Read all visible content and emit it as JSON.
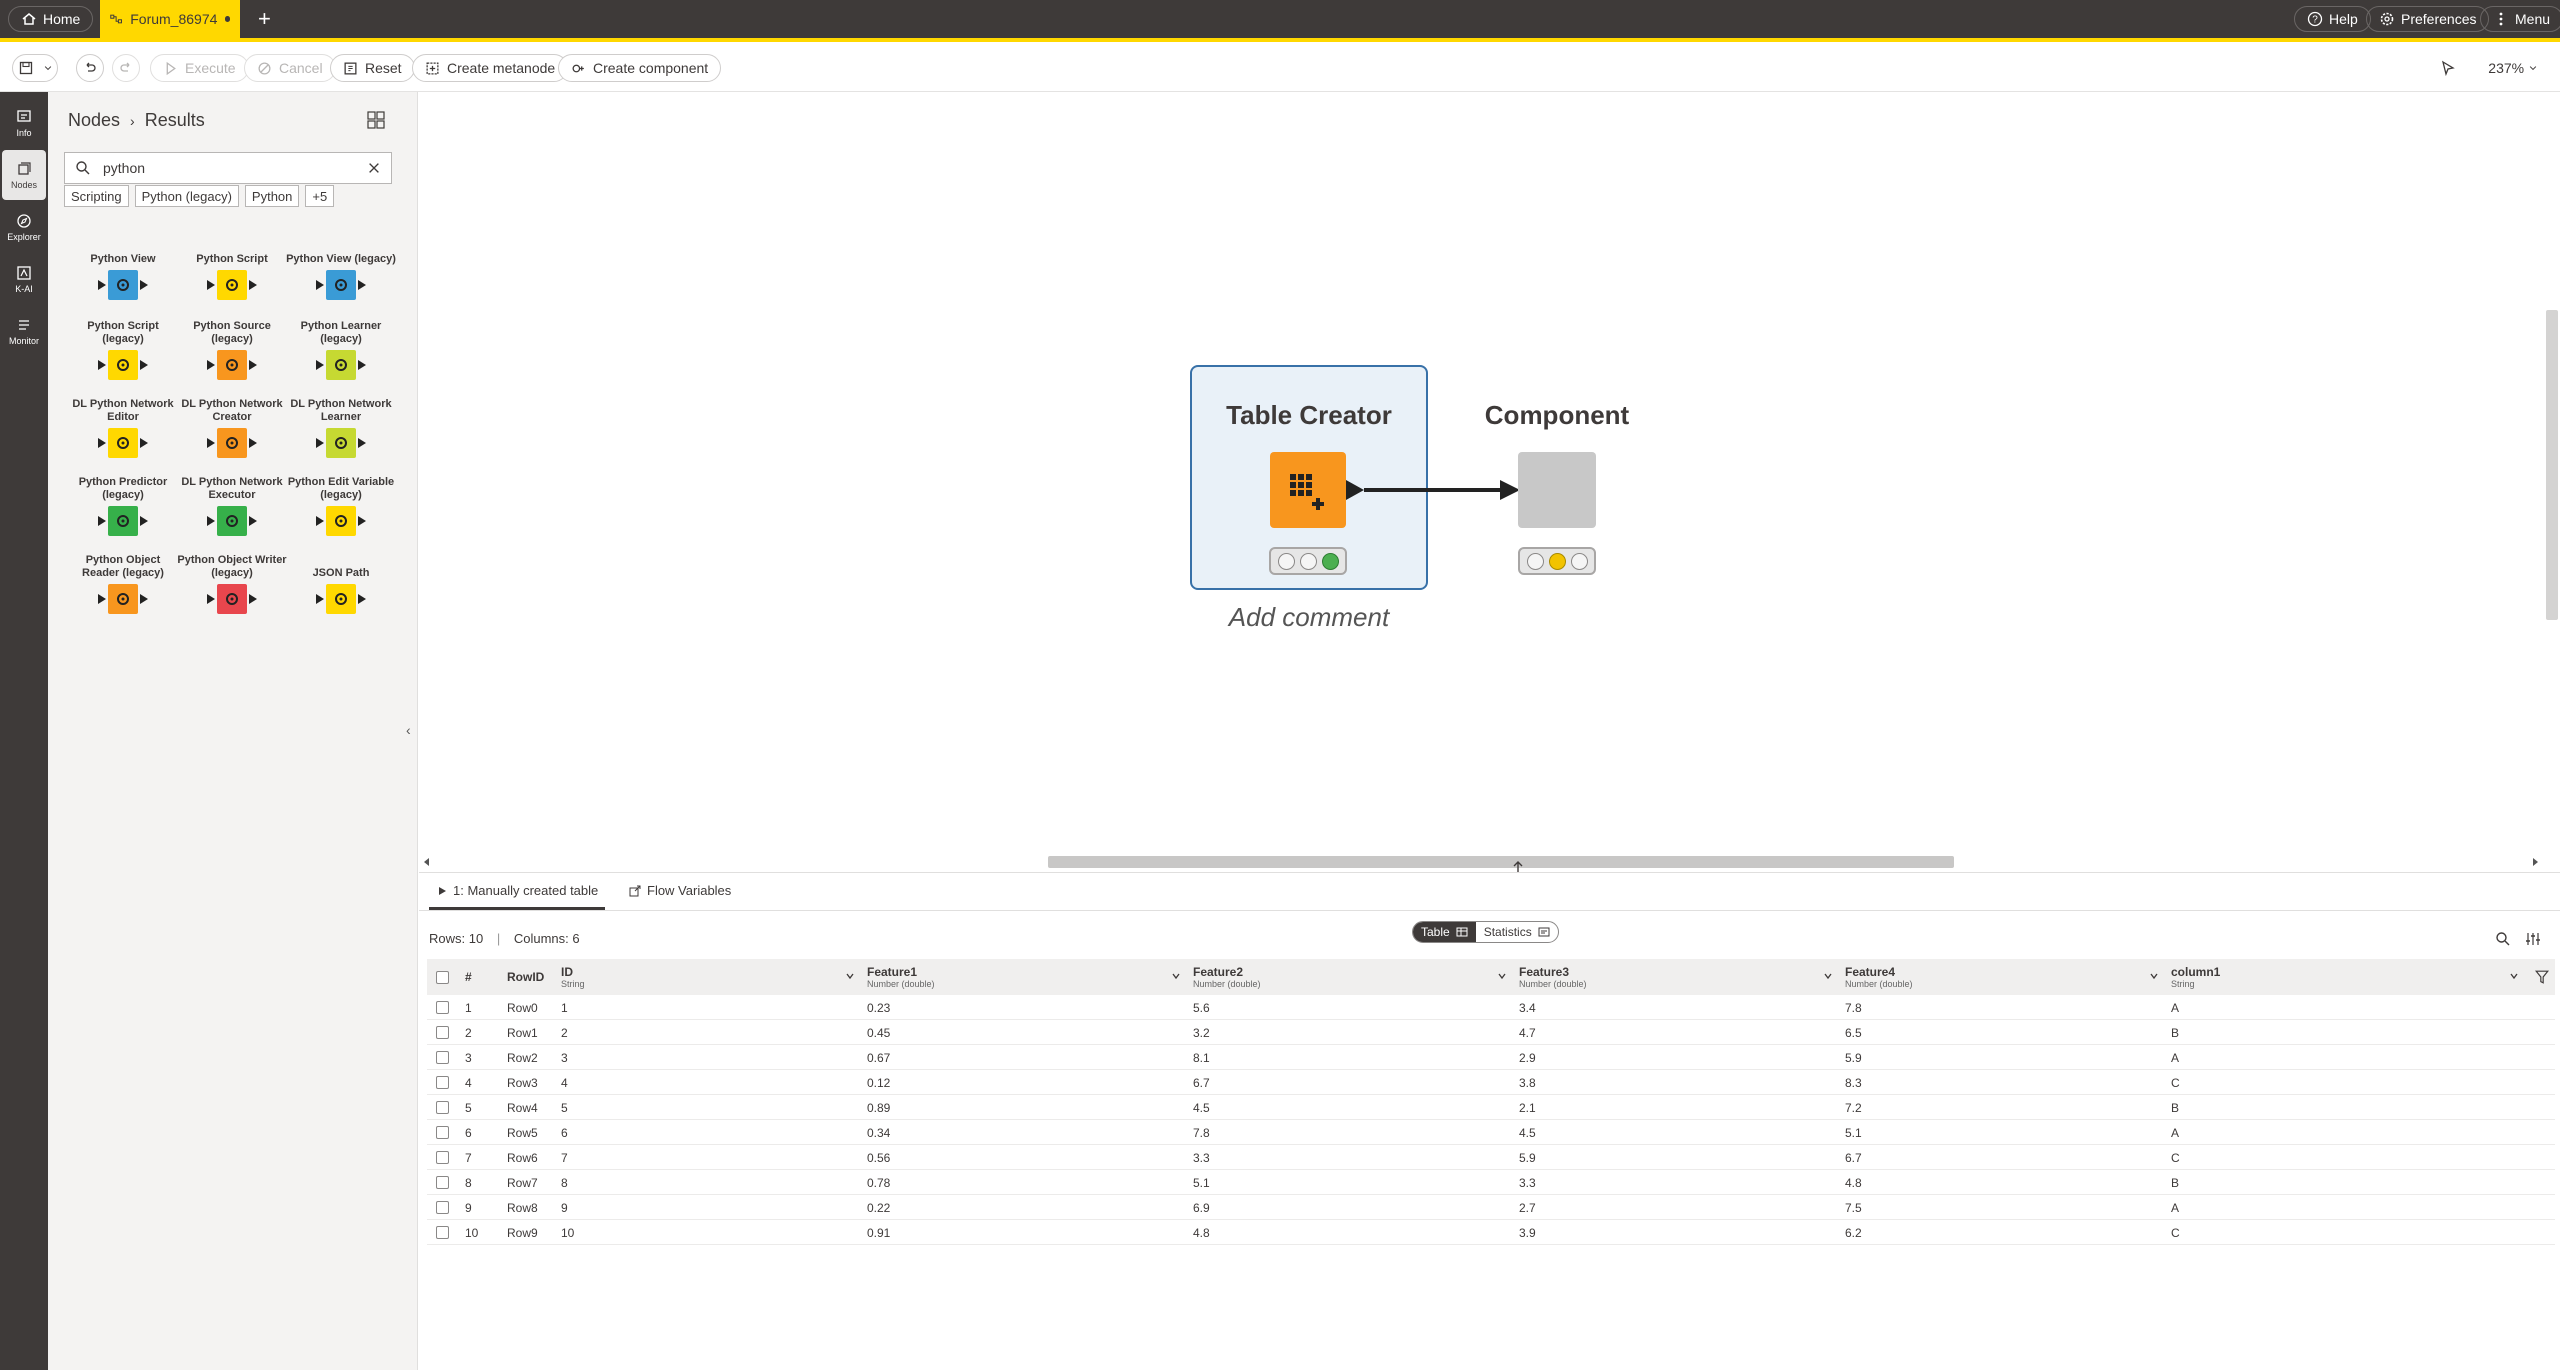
{
  "topbar": {
    "home_label": "Home",
    "tab_label": "Forum_86974",
    "new_tab": "+",
    "help_label": "Help",
    "preferences_label": "Preferences",
    "menu_label": "Menu",
    "accent_color": "#ffd800"
  },
  "toolbar": {
    "execute_label": "Execute",
    "cancel_label": "Cancel",
    "reset_label": "Reset",
    "create_metanode_label": "Create metanode",
    "create_component_label": "Create component",
    "zoom": "237%"
  },
  "rail": {
    "items": [
      {
        "label": "Info",
        "icon": "info-icon"
      },
      {
        "label": "Nodes",
        "icon": "nodes-icon"
      },
      {
        "label": "Explorer",
        "icon": "explorer-icon"
      },
      {
        "label": "K-AI",
        "icon": "kai-icon"
      },
      {
        "label": "Monitor",
        "icon": "monitor-icon"
      }
    ]
  },
  "panel": {
    "breadcrumb_root": "Nodes",
    "breadcrumb_sep": "›",
    "breadcrumb_current": "Results",
    "search_value": "python",
    "tags": [
      "Scripting",
      "Python (legacy)",
      "Python",
      "+5"
    ],
    "nodes": [
      {
        "label": "Python View",
        "color": "#3a9bd6"
      },
      {
        "label": "Python Script",
        "color": "#ffd800"
      },
      {
        "label": "Python View (legacy)",
        "color": "#3a9bd6"
      },
      {
        "label": "Python Script (legacy)",
        "color": "#ffd800"
      },
      {
        "label": "Python Source (legacy)",
        "color": "#f8961e"
      },
      {
        "label": "Python Learner (legacy)",
        "color": "#c6d932"
      },
      {
        "label": "DL Python Network Editor",
        "color": "#ffd800"
      },
      {
        "label": "DL Python Network Creator",
        "color": "#f8961e"
      },
      {
        "label": "DL Python Network Learner",
        "color": "#c6d932"
      },
      {
        "label": "Python Predictor (legacy)",
        "color": "#36b04a"
      },
      {
        "label": "DL Python Network Executor",
        "color": "#36b04a"
      },
      {
        "label": "Python Edit Variable (legacy)",
        "color": "#ffd800"
      },
      {
        "label": "Python Object Reader (legacy)",
        "color": "#f8961e"
      },
      {
        "label": "Python Object Writer (legacy)",
        "color": "#e8464d"
      },
      {
        "label": "JSON Path",
        "color": "#ffd800"
      }
    ]
  },
  "canvas": {
    "node1_title": "Table Creator",
    "node2_title": "Component",
    "comment": "Add comment"
  },
  "bottom": {
    "tab1": "1: Manually created table",
    "tab2": "Flow Variables",
    "rows_label": "Rows: 10",
    "cols_label": "Columns: 6",
    "seg_table": "Table",
    "seg_stats": "Statistics",
    "columns": [
      {
        "name": "#",
        "type": ""
      },
      {
        "name": "RowID",
        "type": ""
      },
      {
        "name": "ID",
        "type": "String"
      },
      {
        "name": "Feature1",
        "type": "Number (double)"
      },
      {
        "name": "Feature2",
        "type": "Number (double)"
      },
      {
        "name": "Feature3",
        "type": "Number (double)"
      },
      {
        "name": "Feature4",
        "type": "Number (double)"
      },
      {
        "name": "column1",
        "type": "String"
      }
    ],
    "rows": [
      [
        "1",
        "Row0",
        "1",
        "0.23",
        "5.6",
        "3.4",
        "7.8",
        "A"
      ],
      [
        "2",
        "Row1",
        "2",
        "0.45",
        "3.2",
        "4.7",
        "6.5",
        "B"
      ],
      [
        "3",
        "Row2",
        "3",
        "0.67",
        "8.1",
        "2.9",
        "5.9",
        "A"
      ],
      [
        "4",
        "Row3",
        "4",
        "0.12",
        "6.7",
        "3.8",
        "8.3",
        "C"
      ],
      [
        "5",
        "Row4",
        "5",
        "0.89",
        "4.5",
        "2.1",
        "7.2",
        "B"
      ],
      [
        "6",
        "Row5",
        "6",
        "0.34",
        "7.8",
        "4.5",
        "5.1",
        "A"
      ],
      [
        "7",
        "Row6",
        "7",
        "0.56",
        "3.3",
        "5.9",
        "6.7",
        "C"
      ],
      [
        "8",
        "Row7",
        "8",
        "0.78",
        "5.1",
        "3.3",
        "4.8",
        "B"
      ],
      [
        "9",
        "Row8",
        "9",
        "0.22",
        "6.9",
        "2.7",
        "7.5",
        "A"
      ],
      [
        "10",
        "Row9",
        "10",
        "0.91",
        "4.8",
        "3.9",
        "6.2",
        "C"
      ]
    ]
  }
}
